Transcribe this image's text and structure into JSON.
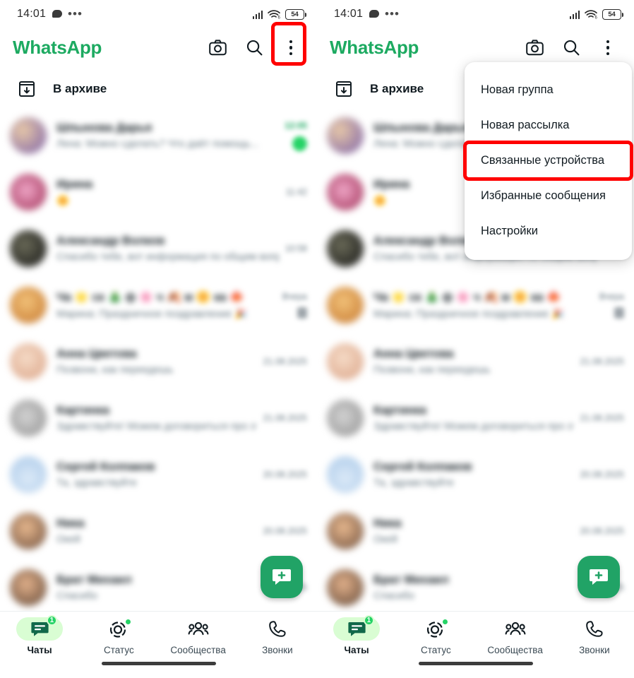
{
  "status_bar": {
    "time": "14:01",
    "notification_icon": "speech-bubble-icon",
    "overflow_icon": "ellipsis-icon",
    "signal_icon": "cellular-signal-icon",
    "wifi_icon": "wifi-6-icon",
    "battery_level": "54"
  },
  "app_bar": {
    "brand": "WhatsApp",
    "camera_icon": "camera-icon",
    "search_icon": "search-icon",
    "menu_icon": "kebab-menu-icon"
  },
  "archive": {
    "label": "В архиве",
    "icon": "archive-box-icon"
  },
  "chats": [
    {
      "name": "Шпынова Дарья",
      "message": "Лена: Можно сделать? Что даёт помощь...",
      "time": "12:05",
      "unread": true,
      "badge": "",
      "muted": true
    },
    {
      "name": "Ирина",
      "message": "🌼",
      "time": "11:42",
      "unread": false,
      "badge": "",
      "muted": false
    },
    {
      "name": "Александр Волков",
      "message": "Спасибо тебе, вот информация по общим вопросам",
      "time": "10:58",
      "unread": false,
      "badge": "",
      "muted": false
    },
    {
      "name": "Ча 🌟 ск 🎄 ф 🌸 ч 🍂 м 🌼 ка 🍁",
      "message": "Марина: Праздничное поздравление 🎉",
      "time": "Вчера",
      "unread": false,
      "badge": "",
      "muted": true
    },
    {
      "name": "Анна Цветова",
      "message": "Позвони, как переедешь",
      "time": "21.08.2025",
      "unread": false,
      "badge": "",
      "muted": false
    },
    {
      "name": "Картинка",
      "message": "Здравствуйте! Можем договориться про это",
      "time": "21.08.2025",
      "unread": false,
      "badge": "",
      "muted": false
    },
    {
      "name": "Сергей Колпаков",
      "message": "Та, здравствуйте",
      "time": "20.08.2025",
      "unread": false,
      "badge": "",
      "muted": false
    },
    {
      "name": "Ника",
      "message": "Окей",
      "time": "20.08.2025",
      "unread": false,
      "badge": "",
      "muted": false
    },
    {
      "name": "Брат Михаил",
      "message": "Спасибо",
      "time": "19.08.2025",
      "unread": false,
      "badge": "",
      "muted": false
    }
  ],
  "fab": {
    "icon": "new-chat-icon"
  },
  "bottom_nav": [
    {
      "label": "Чаты",
      "icon": "chats-icon",
      "active": true,
      "badge": "1"
    },
    {
      "label": "Статус",
      "icon": "status-ring-icon",
      "active": false,
      "badge": ""
    },
    {
      "label": "Сообщества",
      "icon": "communities-icon",
      "active": false,
      "badge": ""
    },
    {
      "label": "Звонки",
      "icon": "phone-icon",
      "active": false,
      "badge": ""
    }
  ],
  "overflow_menu": {
    "items": [
      {
        "label": "Новая группа",
        "highlighted": false
      },
      {
        "label": "Новая рассылка",
        "highlighted": false
      },
      {
        "label": "Связанные устройства",
        "highlighted": true
      },
      {
        "label": "Избранные сообщения",
        "highlighted": false
      },
      {
        "label": "Настройки",
        "highlighted": false
      }
    ]
  },
  "annotations": {
    "highlight_color": "#FF0000",
    "left_panel_target": "kebab-menu-icon",
    "right_panel_target": "Связанные устройства"
  },
  "colors": {
    "brand_green": "#1DAA61",
    "badge_green": "#25D366",
    "pill_green": "#D9FDD3",
    "fab_green": "#21A366",
    "text_primary": "#111b21",
    "text_secondary": "#667781"
  }
}
